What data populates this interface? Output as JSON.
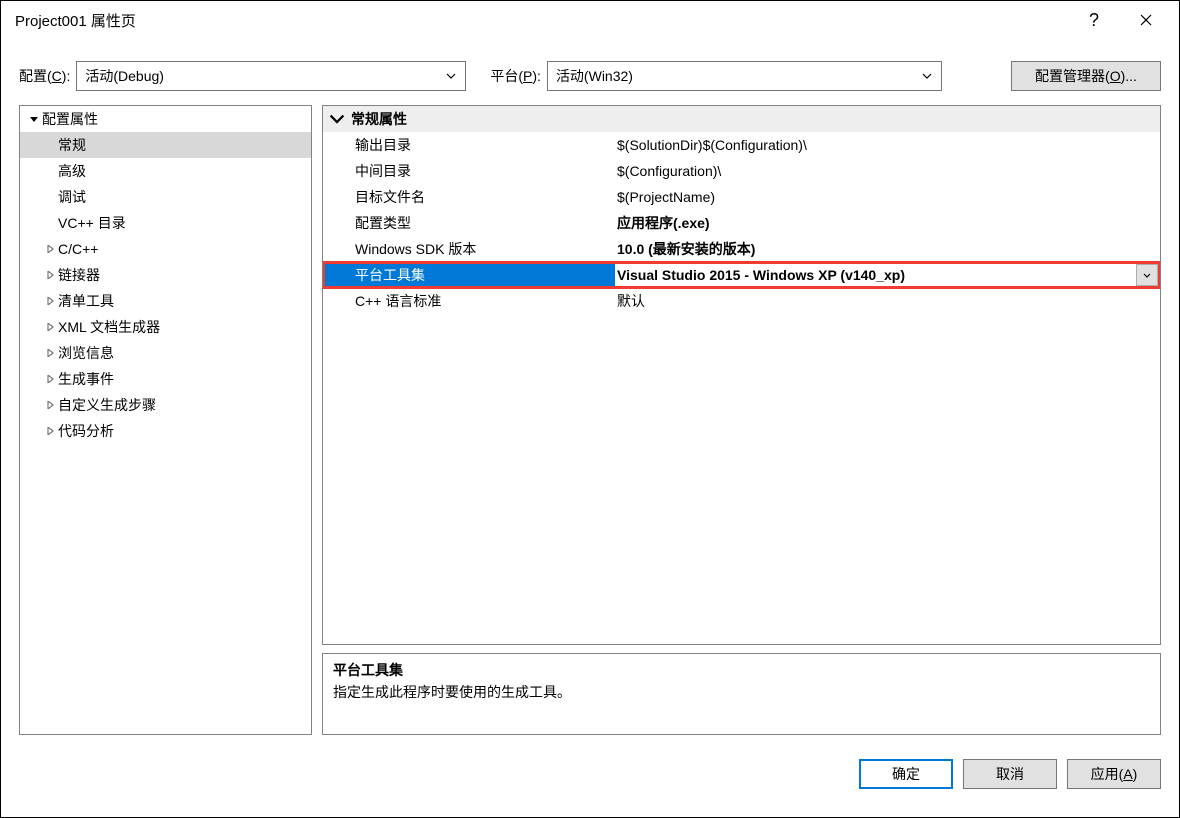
{
  "title": "Project001 属性页",
  "winButtons": {
    "help": "?",
    "close": "✕"
  },
  "configRow": {
    "configLabel": "配置(C):",
    "configValue": "活动(Debug)",
    "platformLabel": "平台(P):",
    "platformValue": "活动(Win32)",
    "configManager": "配置管理器(O)..."
  },
  "tree": {
    "root": "配置属性",
    "items": [
      {
        "label": "常规",
        "selected": true,
        "expander": false
      },
      {
        "label": "高级",
        "expander": false
      },
      {
        "label": "调试",
        "expander": false
      },
      {
        "label": "VC++ 目录",
        "expander": false
      },
      {
        "label": "C/C++",
        "expander": true
      },
      {
        "label": "链接器",
        "expander": true
      },
      {
        "label": "清单工具",
        "expander": true
      },
      {
        "label": "XML 文档生成器",
        "expander": true
      },
      {
        "label": "浏览信息",
        "expander": true
      },
      {
        "label": "生成事件",
        "expander": true
      },
      {
        "label": "自定义生成步骤",
        "expander": true
      },
      {
        "label": "代码分析",
        "expander": true
      }
    ]
  },
  "propgrid": {
    "sectionTitle": "常规属性",
    "rows": [
      {
        "name": "输出目录",
        "value": "$(SolutionDir)$(Configuration)\\",
        "bold": false
      },
      {
        "name": "中间目录",
        "value": "$(Configuration)\\",
        "bold": false
      },
      {
        "name": "目标文件名",
        "value": "$(ProjectName)",
        "bold": false
      },
      {
        "name": "配置类型",
        "value": "应用程序(.exe)",
        "bold": true
      },
      {
        "name": "Windows SDK 版本",
        "value": "10.0 (最新安装的版本)",
        "bold": true
      },
      {
        "name": "平台工具集",
        "value": "Visual Studio 2015 - Windows XP (v140_xp)",
        "bold": true,
        "highlighted": true,
        "dropdown": true
      },
      {
        "name": "C++ 语言标准",
        "value": "默认",
        "bold": false
      }
    ]
  },
  "description": {
    "title": "平台工具集",
    "body": "指定生成此程序时要使用的生成工具。"
  },
  "footer": {
    "ok": "确定",
    "cancel": "取消",
    "apply": "应用(A)"
  }
}
